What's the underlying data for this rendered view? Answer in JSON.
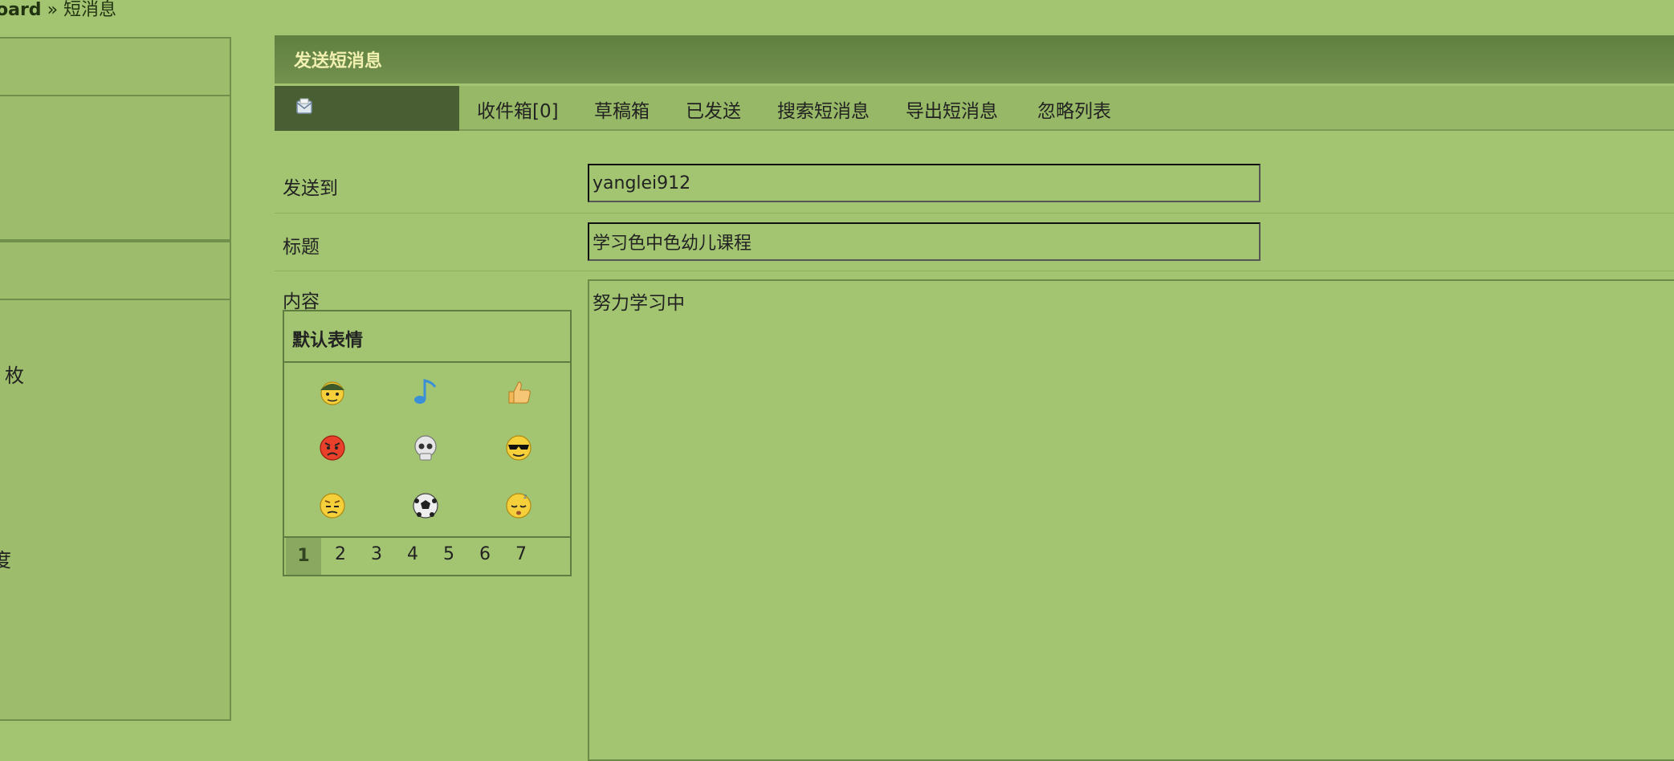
{
  "breadcrumb": {
    "prefix": "oard",
    "separator": "»",
    "current": "短消息"
  },
  "sidebar": {
    "text_a": "枚",
    "text_b": "度"
  },
  "panel": {
    "title": "发送短消息"
  },
  "nav": {
    "icon": "mail-envelope-icon",
    "tabs": [
      {
        "label": "收件箱[0]"
      },
      {
        "label": "草稿箱"
      },
      {
        "label": "已发送"
      },
      {
        "label": "搜索短消息"
      },
      {
        "label": "导出短消息"
      },
      {
        "label": "忽略列表"
      }
    ]
  },
  "form": {
    "to_label": "发送到",
    "to_value": "yanglei912",
    "subject_label": "标题",
    "subject_value": "学习色中色幼儿课程",
    "content_label": "内容",
    "content_value": "努力学习中"
  },
  "smilies": {
    "title": "默认表情",
    "icons": [
      "soldier-smiley-icon",
      "music-note-icon",
      "thumbs-up-icon",
      "angry-smiley-icon",
      "skull-icon",
      "cool-sunglasses-smiley-icon",
      "frown-smiley-icon",
      "soccer-ball-icon",
      "sleepy-smiley-icon"
    ],
    "pages": [
      "1",
      "2",
      "3",
      "4",
      "5",
      "6",
      "7"
    ],
    "active_page": "1"
  },
  "colors": {
    "background": "#a3c572",
    "header": "#5f8040",
    "header_text": "#f1f0b0",
    "nav_icon_cell": "#4a5e33"
  }
}
